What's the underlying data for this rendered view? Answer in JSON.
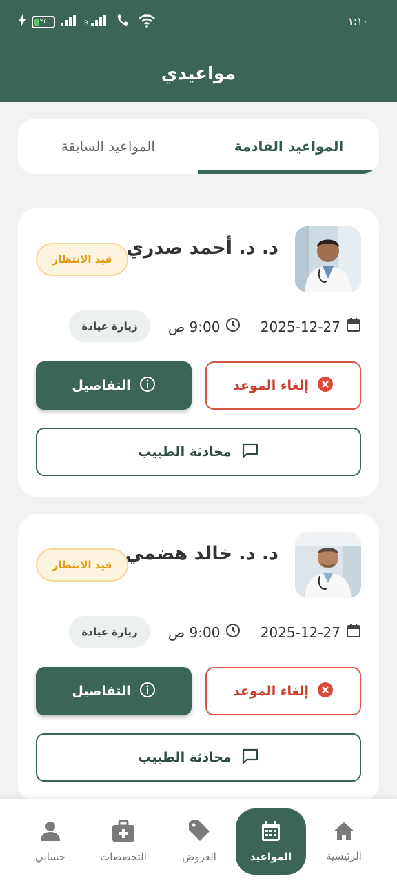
{
  "status": {
    "time": "١:١٠",
    "battery": "٢٤"
  },
  "header": {
    "title": "مواعيدي"
  },
  "tabs": {
    "upcoming": "المواعيد القادمة",
    "past": "المواعيد السابقة"
  },
  "appointments": [
    {
      "doctor": "د. د. أحمد صدري",
      "status": "قيد الانتظار",
      "date": "2025-12-27",
      "time": "9:00 ص",
      "type": "زيارة عيادة",
      "cancel": "إلغاء الموعد",
      "details": "التفاصيل",
      "chat": "محادثة الطبيب"
    },
    {
      "doctor": "د. د. خالد هضمي",
      "status": "قيد الانتظار",
      "date": "2025-12-27",
      "time": "9:00 ص",
      "type": "زيارة عيادة",
      "cancel": "إلغاء الموعد",
      "details": "التفاصيل",
      "chat": "محادثة الطبيب"
    }
  ],
  "nav": {
    "home": "الرئيسية",
    "appointments": "المواعيد",
    "offers": "العروض",
    "specialties": "التخصصات",
    "account": "حسابي"
  },
  "colors": {
    "primary": "#3b6558",
    "cancel": "#d95646",
    "pending": "#e39a12"
  }
}
